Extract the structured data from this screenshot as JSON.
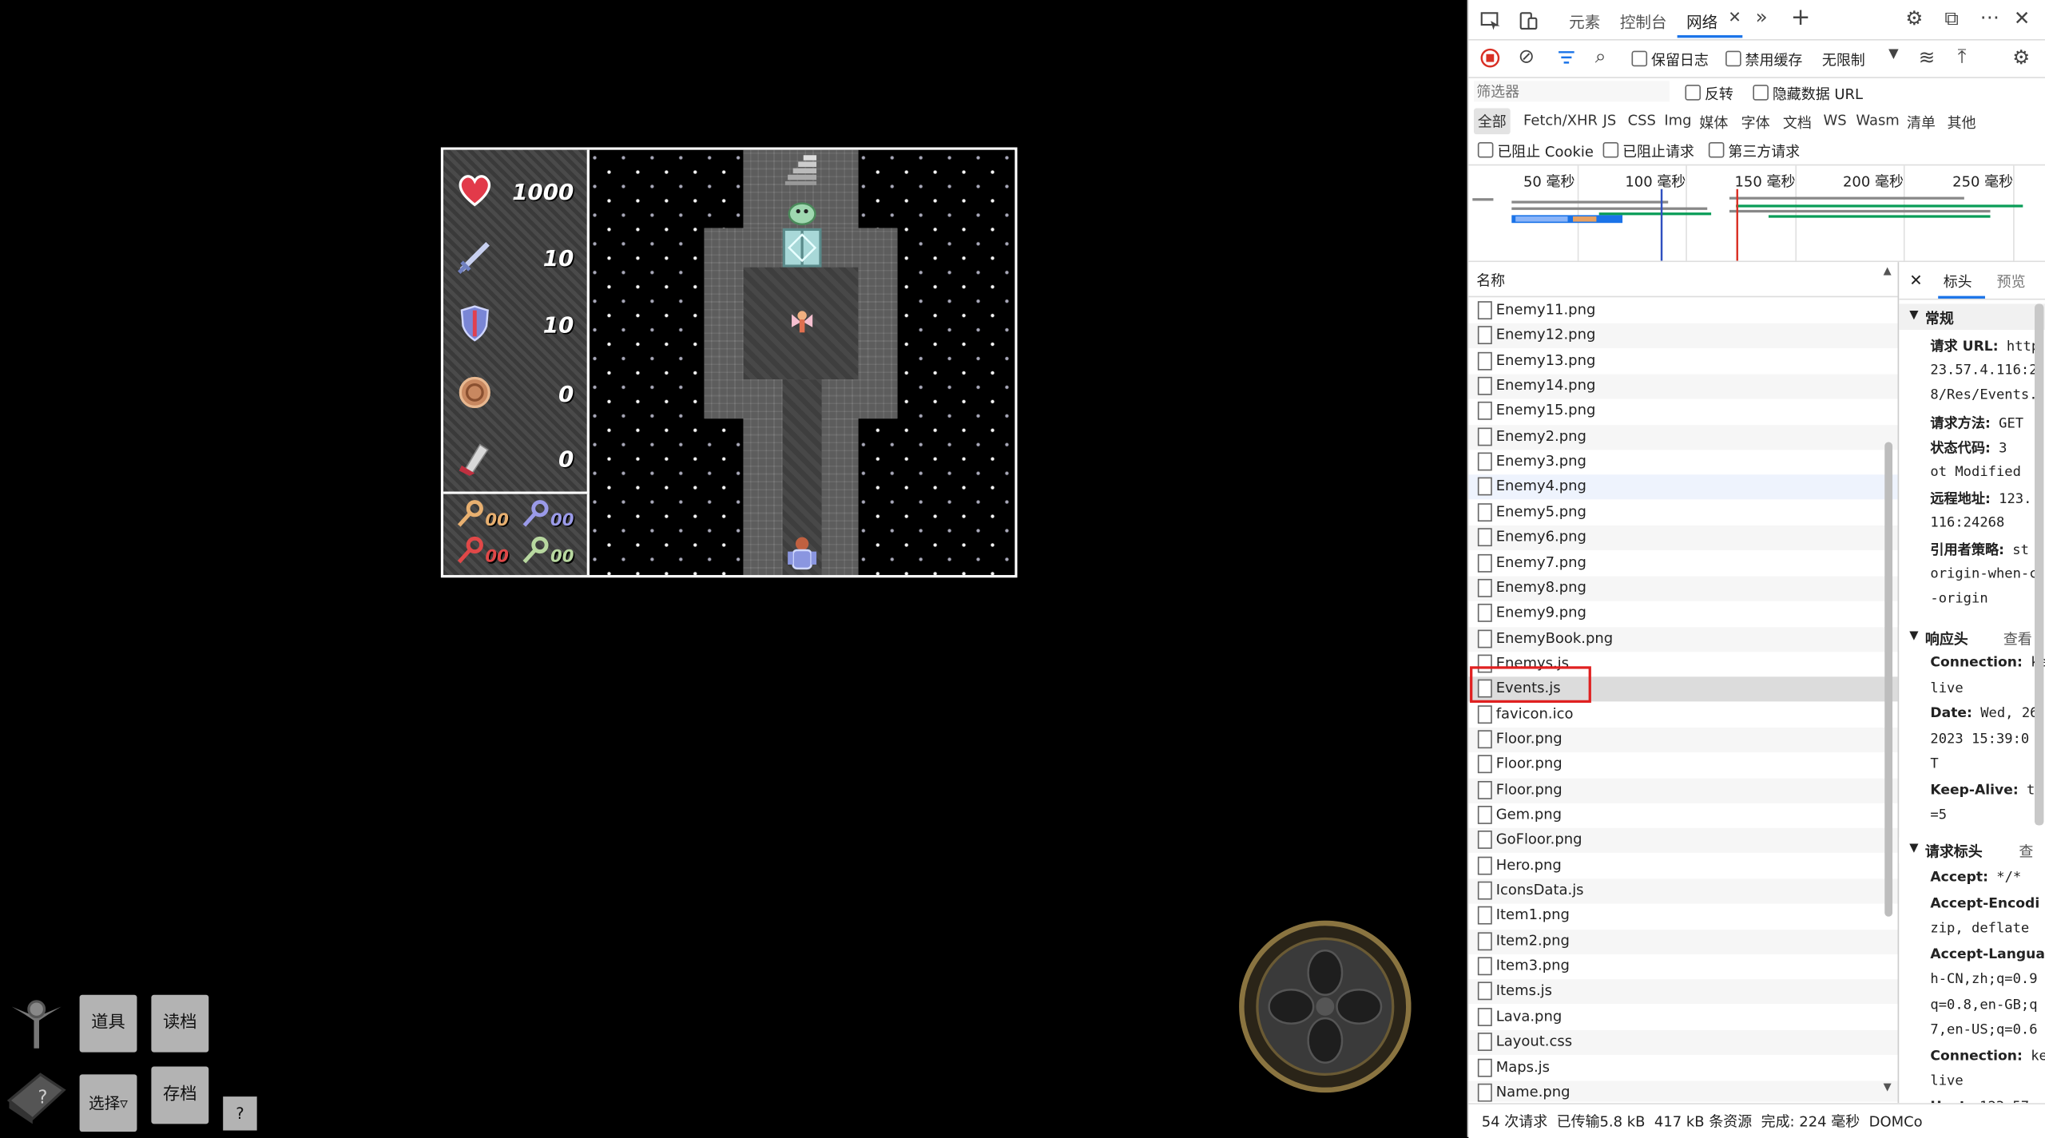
{
  "game": {
    "stats": [
      {
        "name": "hp",
        "icon": "heart-icon",
        "value": "1000"
      },
      {
        "name": "attack",
        "icon": "sword-icon",
        "value": "10"
      },
      {
        "name": "defense",
        "icon": "shield-icon",
        "value": "10"
      },
      {
        "name": "gold",
        "icon": "coin-icon",
        "value": "0"
      },
      {
        "name": "experience",
        "icon": "scroll-icon",
        "value": "0"
      }
    ],
    "keys": [
      {
        "color": "#e8b070",
        "value": "00"
      },
      {
        "color": "#9a9ae8",
        "value": "00"
      },
      {
        "color": "#e04848",
        "value": "00"
      },
      {
        "color": "#b8d8a0",
        "value": "00"
      }
    ],
    "controls": {
      "items_label": "道具",
      "load_label": "读档",
      "select_label": "选择▿",
      "save_label": "存档",
      "help_label": "?"
    }
  },
  "devtools": {
    "tabs": [
      "元素",
      "控制台",
      "网络"
    ],
    "active_tab": "网络",
    "toolbar": {
      "preserve_log": "保留日志",
      "disable_cache": "禁用缓存",
      "throttle": "无限制"
    },
    "filter": {
      "placeholder": "筛选器",
      "invert": "反转",
      "hide_data_urls": "隐藏数据 URL",
      "types": [
        "全部",
        "Fetch/XHR",
        "JS",
        "CSS",
        "Img",
        "媒体",
        "字体",
        "文档",
        "WS",
        "Wasm",
        "清单",
        "其他"
      ],
      "blocked_cookies": "已阻止 Cookie",
      "blocked_requests": "已阻止请求",
      "third_party": "第三方请求"
    },
    "timeline_ticks": [
      "50 毫秒",
      "100 毫秒",
      "150 毫秒",
      "200 毫秒",
      "250 毫秒"
    ],
    "list_header": "名称",
    "files": [
      "Enemy11.png",
      "Enemy12.png",
      "Enemy13.png",
      "Enemy14.png",
      "Enemy15.png",
      "Enemy2.png",
      "Enemy3.png",
      "Enemy4.png",
      "Enemy5.png",
      "Enemy6.png",
      "Enemy7.png",
      "Enemy8.png",
      "Enemy9.png",
      "EnemyBook.png",
      "Enemys.js",
      "Events.js",
      "favicon.ico",
      "Floor.png",
      "Floor.png",
      "Floor.png",
      "Gem.png",
      "GoFloor.png",
      "Hero.png",
      "IconsData.js",
      "Item1.png",
      "Item2.png",
      "Item3.png",
      "Items.js",
      "Lava.png",
      "Layout.css",
      "Maps.js",
      "Name.png"
    ],
    "selected_file": "Events.js",
    "details": {
      "tabs": [
        "标头",
        "预览"
      ],
      "general_title": "常规",
      "lines": [
        {
          "k": "请求 URL:",
          "v": " http"
        },
        {
          "k": "",
          "v": "23.57.4.116:2"
        },
        {
          "k": "",
          "v": "8/Res/Events."
        },
        {
          "k": "请求方法:",
          "v": " GET"
        },
        {
          "k": "状态代码:",
          "v": " 3"
        },
        {
          "k": "",
          "v": "ot Modified"
        },
        {
          "k": "远程地址:",
          "v": " 123."
        },
        {
          "k": "",
          "v": "116:24268"
        },
        {
          "k": "引用者策略:",
          "v": " st"
        },
        {
          "k": "",
          "v": "origin-when-c"
        },
        {
          "k": "",
          "v": "-origin"
        }
      ],
      "response_title": "响应头",
      "response_view": "查看",
      "response_lines": [
        {
          "k": "Connection:",
          "v": " ke"
        },
        {
          "k": "",
          "v": "live"
        },
        {
          "k": "Date:",
          "v": " Wed, 26"
        },
        {
          "k": "",
          "v": "2023 15:39:0"
        },
        {
          "k": "",
          "v": "T"
        },
        {
          "k": "Keep-Alive:",
          "v": " ti"
        },
        {
          "k": "",
          "v": "=5"
        }
      ],
      "request_title": "请求标头",
      "request_view": "查",
      "request_lines": [
        {
          "k": "Accept:",
          "v": " */*"
        },
        {
          "k": "Accept-Encodi",
          "v": ""
        },
        {
          "k": "",
          "v": "zip, deflate"
        },
        {
          "k": "Accept-Langua",
          "v": ""
        },
        {
          "k": "",
          "v": "h-CN,zh;q=0.9"
        },
        {
          "k": "",
          "v": "q=0.8,en-GB;q"
        },
        {
          "k": "",
          "v": "7,en-US;q=0.6"
        },
        {
          "k": "Connection:",
          "v": " ke"
        },
        {
          "k": "",
          "v": "live"
        },
        {
          "k": "Host:",
          "v": " 123.57."
        }
      ]
    },
    "status_bar": "54 次请求  已传输5.8 kB  417 kB 条资源  完成: 224 毫秒  DOMCo"
  }
}
